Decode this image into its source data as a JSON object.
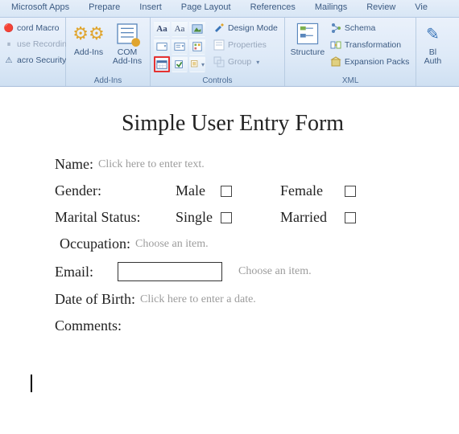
{
  "tabs": {
    "apps": "Microsoft Apps",
    "prepare": "Prepare",
    "insert": "Insert",
    "page_layout": "Page Layout",
    "references": "References",
    "mailings": "Mailings",
    "review": "Review",
    "view": "Vie"
  },
  "ribbon": {
    "code": {
      "record": "cord Macro",
      "pause": "use Recording",
      "security": "acro Security"
    },
    "addins": {
      "addins": "Add-Ins",
      "com": "COM\nAdd-Ins",
      "group_label": "Add-Ins"
    },
    "controls": {
      "design_mode": "Design Mode",
      "properties": "Properties",
      "group": "Group",
      "group_label": "Controls"
    },
    "xml": {
      "structure": "Structure",
      "schema": "Schema",
      "transformation": "Transformation",
      "expansion": "Expansion Packs",
      "group_label": "XML"
    },
    "right": {
      "bl": "Bl",
      "auth": "Auth"
    }
  },
  "doc": {
    "title": "Simple User Entry Form",
    "name_label": "Name:",
    "name_placeholder": "Click here to enter text.",
    "gender_label": "Gender:",
    "gender_opt1": "Male",
    "gender_opt2": "Female",
    "marital_label": "Marital Status:",
    "marital_opt1": "Single",
    "marital_opt2": "Married",
    "occupation_label": "Occupation:",
    "occupation_placeholder": "Choose an item.",
    "email_label": "Email:",
    "email_placeholder": "Choose an item.",
    "dob_label": "Date of Birth:",
    "dob_placeholder": "Click here to enter a date.",
    "comments_label": "Comments:"
  }
}
